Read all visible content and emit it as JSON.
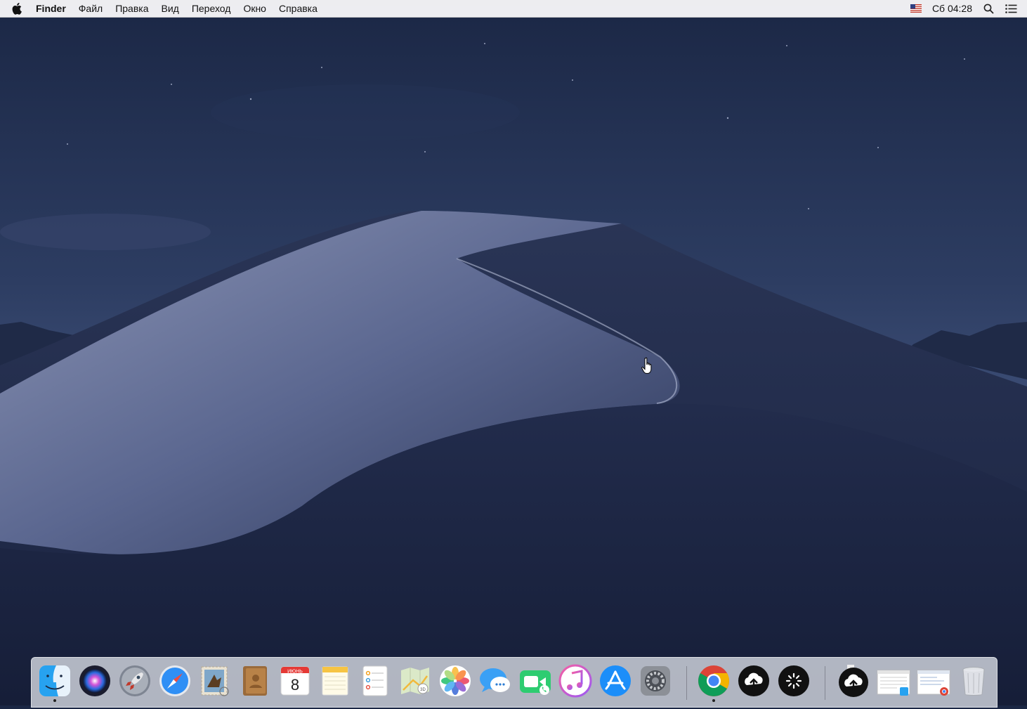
{
  "menubar": {
    "active_app": "Finder",
    "menus": [
      "Файл",
      "Правка",
      "Вид",
      "Переход",
      "Окно",
      "Справка"
    ],
    "clock": "Сб 04:28",
    "input_source_icon": "us-flag-icon",
    "status_icons": [
      "search-icon",
      "notification-list-icon"
    ]
  },
  "wallpaper": {
    "name": "macOS Mojave Night",
    "sky_color": "#2b3a5c",
    "dune_color": "#7a86a8"
  },
  "calendar_icon": {
    "month": "ИЮНЬ",
    "day": "8"
  },
  "dock": {
    "apps": [
      {
        "name": "finder",
        "running": true
      },
      {
        "name": "siri",
        "running": false
      },
      {
        "name": "launchpad",
        "running": false
      },
      {
        "name": "safari",
        "running": false
      },
      {
        "name": "mail",
        "running": false
      },
      {
        "name": "contacts",
        "running": false
      },
      {
        "name": "calendar",
        "running": false
      },
      {
        "name": "notes",
        "running": false
      },
      {
        "name": "reminders",
        "running": false
      },
      {
        "name": "maps",
        "running": false
      },
      {
        "name": "photos",
        "running": false
      },
      {
        "name": "messages",
        "running": false
      },
      {
        "name": "facetime",
        "running": false
      },
      {
        "name": "itunes",
        "running": false
      },
      {
        "name": "app-store",
        "running": false
      },
      {
        "name": "system-preferences",
        "running": false
      },
      {
        "name": "chrome",
        "running": true
      },
      {
        "name": "upload-app",
        "running": false
      },
      {
        "name": "loading-app",
        "running": false
      }
    ],
    "right_items": [
      "upload-app-minimized",
      "finder-window-thumbnail",
      "chrome-window-thumbnail",
      "trash"
    ]
  }
}
